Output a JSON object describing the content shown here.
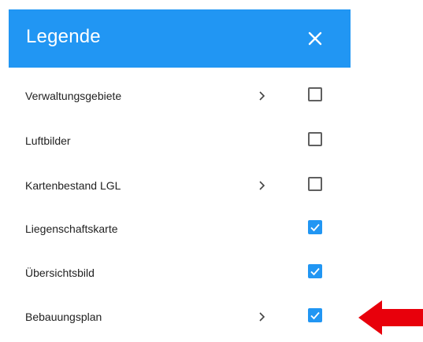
{
  "legend": {
    "title": "Legende",
    "close_icon": "close-icon",
    "accent_color": "#2196f3",
    "items": [
      {
        "label": "Verwaltungsgebiete",
        "has_submenu": true,
        "checked": false
      },
      {
        "label": "Luftbilder",
        "has_submenu": false,
        "checked": false
      },
      {
        "label": "Kartenbestand LGL",
        "has_submenu": true,
        "checked": false
      },
      {
        "label": "Liegenschaftskarte",
        "has_submenu": false,
        "checked": true
      },
      {
        "label": "Übersichtsbild",
        "has_submenu": false,
        "checked": true
      },
      {
        "label": "Bebauungsplan",
        "has_submenu": true,
        "checked": true
      }
    ]
  },
  "annotation": {
    "icon": "red-arrow-icon",
    "color": "#e8000b"
  }
}
